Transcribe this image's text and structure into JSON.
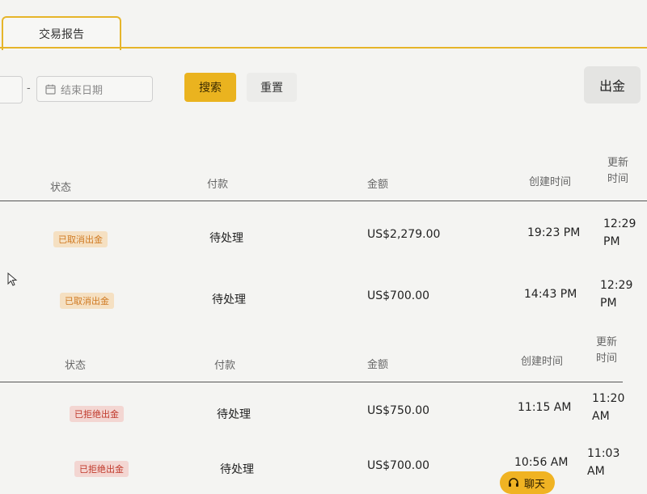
{
  "tabs": [
    {
      "label": "交易报告"
    }
  ],
  "filters": {
    "date_separator": "-",
    "end_date_placeholder": "结束日期",
    "search_label": "搜索",
    "reset_label": "重置",
    "withdraw_label": "出金"
  },
  "table": {
    "headers": {
      "status": "状态",
      "payment": "付款",
      "amount": "金额",
      "created": "创建时间",
      "updated_line1": "更新",
      "updated_line2": "时间"
    },
    "group1": [
      {
        "status": "已取消出金",
        "payment": "待处理",
        "amount": "US$2,279.00",
        "created": "19:23 PM",
        "updated_line1": "12:29",
        "updated_line2": "PM"
      },
      {
        "status": "已取消出金",
        "payment": "待处理",
        "amount": "US$700.00",
        "created": "14:43 PM",
        "updated_line1": "12:29",
        "updated_line2": "PM"
      }
    ],
    "group2": [
      {
        "status": "已拒绝出金",
        "payment": "待处理",
        "amount": "US$750.00",
        "created": "11:15 AM",
        "updated_line1": "11:20",
        "updated_line2": "AM"
      },
      {
        "status": "已拒绝出金",
        "payment": "待处理",
        "amount": "US$700.00",
        "created": "10:56 AM",
        "updated_line1": "11:03",
        "updated_line2": "AM"
      }
    ]
  },
  "chat": {
    "label": "聊天"
  },
  "colors": {
    "accent": "#e6b52a",
    "cancelled": "#d07a22",
    "rejected": "#c0392b"
  }
}
